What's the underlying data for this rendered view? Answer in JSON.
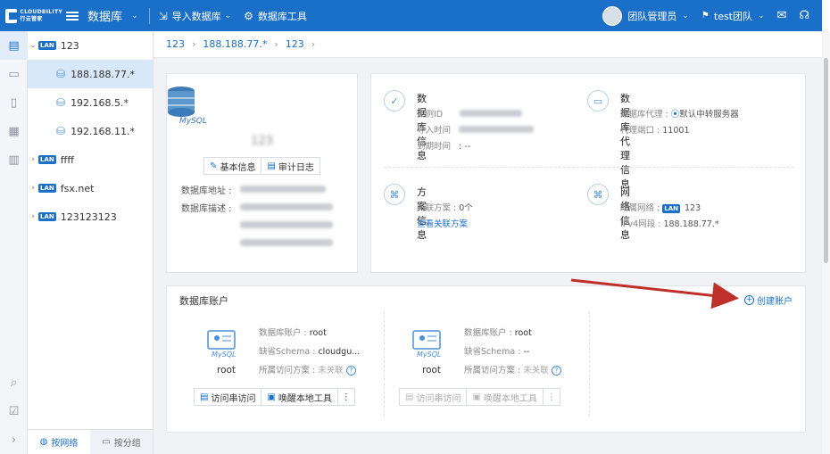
{
  "topbar": {
    "logo_text": "CLOUDBILITY",
    "logo_subtext": "行云管家",
    "app_title": "数据库",
    "import_label": "导入数据库",
    "tools_label": "数据库工具",
    "user_label": "团队管理员",
    "team_label": "test团队",
    "icons": [
      "menu-icon",
      "import-icon",
      "tools-icon",
      "mail-icon",
      "headset-icon"
    ]
  },
  "tree": {
    "items": [
      {
        "label": "123",
        "lan": "LAN",
        "expanded": true
      },
      {
        "label": "188.188.77.*",
        "selected": true
      },
      {
        "label": "192.168.5.*"
      },
      {
        "label": "192.168.11.*"
      },
      {
        "label": "ffff",
        "lan": "LAN"
      },
      {
        "label": "fsx.net",
        "lan": "LAN"
      },
      {
        "label": "123123123",
        "lan": "LAN"
      }
    ],
    "tab_network": "按网络",
    "tab_group": "按分组"
  },
  "breadcrumb": [
    "123",
    "188.188.77.*",
    "123"
  ],
  "db_card": {
    "name": "123",
    "engine": "MySQL",
    "basic_info_label": "基本信息",
    "audit_log_label": "审计日志",
    "address_label": "数据库地址 :",
    "desc_label": "数据库描述 :"
  },
  "info": {
    "db_info": {
      "title": "数据库信息",
      "instance_label": "实例ID",
      "import_label": "导入时间",
      "expire_label": "到期时间",
      "expire_value": ": --"
    },
    "proxy_info": {
      "title": "数据库代理信息",
      "proxy_label": "数据库代理 :",
      "proxy_value": "默认中转服务器",
      "port_label": "代理端口 :",
      "port_value": "11001"
    },
    "plan_info": {
      "title": "方案信息",
      "plan_label": "关联方案 :",
      "plan_value": "0个",
      "link": "查看关联方案"
    },
    "net_info": {
      "title": "网络信息",
      "net_label": "所属网络 :",
      "lan": "LAN",
      "net_value": "123",
      "ip_label": "IPv4网段 :",
      "ip_value": "188.188.77.*"
    }
  },
  "accounts": {
    "title": "数据库账户",
    "create_label": "创建账户",
    "account_label": "数据库账户",
    "schema_label": "缺省Schema",
    "plan_label": "所属访问方案",
    "items": [
      {
        "name": "root",
        "account": "root",
        "schema": "cloudgu...",
        "plan": "未关联",
        "btn1": "访问串访问",
        "btn2": "唤醒本地工具"
      },
      {
        "name": "root",
        "account": "root",
        "schema": "--",
        "plan": "未关联",
        "btn1": "访问串访问",
        "btn2": "唤醒本地工具"
      }
    ]
  },
  "colors": {
    "brand": "#1a6fc9",
    "arrow": "#c0302a"
  }
}
